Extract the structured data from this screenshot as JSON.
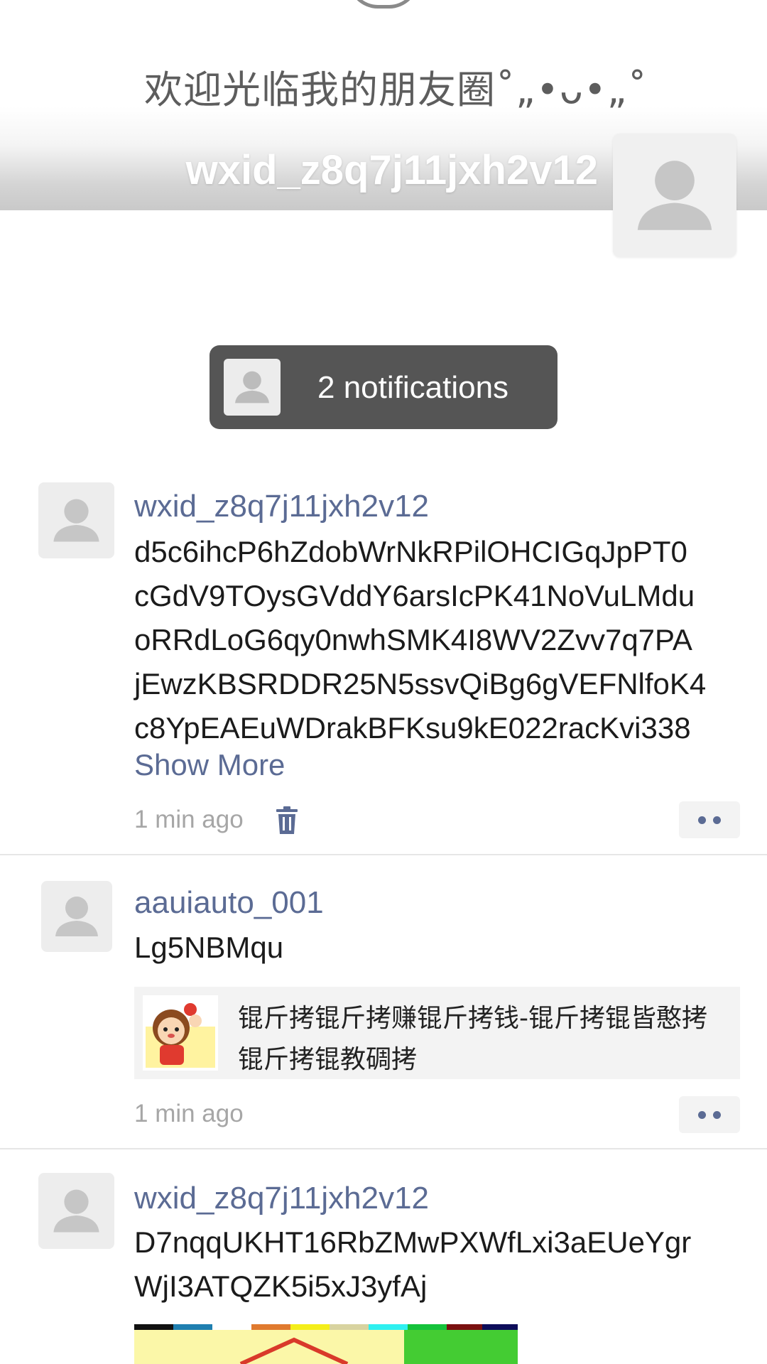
{
  "cover": {
    "banner_text": "欢迎光临我的朋友圈˚„•ᴗ•„˚",
    "profile_name": "wxid_z8q7j11jxh2v12"
  },
  "notification": {
    "label": "2 notifications"
  },
  "posts": [
    {
      "author": "wxid_z8q7j11jxh2v12",
      "lines": [
        "d5c6ihcP6hZdobWrNkRPilOHCIGqJpPT0",
        "cGdV9TOysGVddY6arsIcPK41NoVuLMdu",
        "oRRdLoG6qy0nwhSMK4I8WV2Zvv7q7PA",
        "jEwzKBSRDDR25N5ssvQiBg6gVEFNlfoK4",
        "c8YpEAEuWDrakBFKsu9kE022racKvi338"
      ],
      "show_more": "Show More",
      "time": "1 min ago"
    },
    {
      "author": "aauiauto_001",
      "lines": [
        "Lg5NBMqu"
      ],
      "link_title_line1": "锟斤拷锟斤拷赚锟斤拷钱-锟斤拷锟皆憨拷",
      "link_title_line2": "锟斤拷锟教碉拷",
      "time": "1 min ago"
    },
    {
      "author": "wxid_z8q7j11jxh2v12",
      "lines": [
        "D7nqqUKHT16RbZMwPXWfLxi3aEUeYgr",
        "WjI3ATQZK5i5xJ3yfAj"
      ]
    }
  ],
  "colors": {
    "link_blue": "#5b6b94",
    "notification_bg": "#555555",
    "time_gray": "#a6a6a6"
  },
  "icons": {
    "avatar": "default-user-icon",
    "trash": "trash-icon",
    "more": "more-dots-icon"
  }
}
